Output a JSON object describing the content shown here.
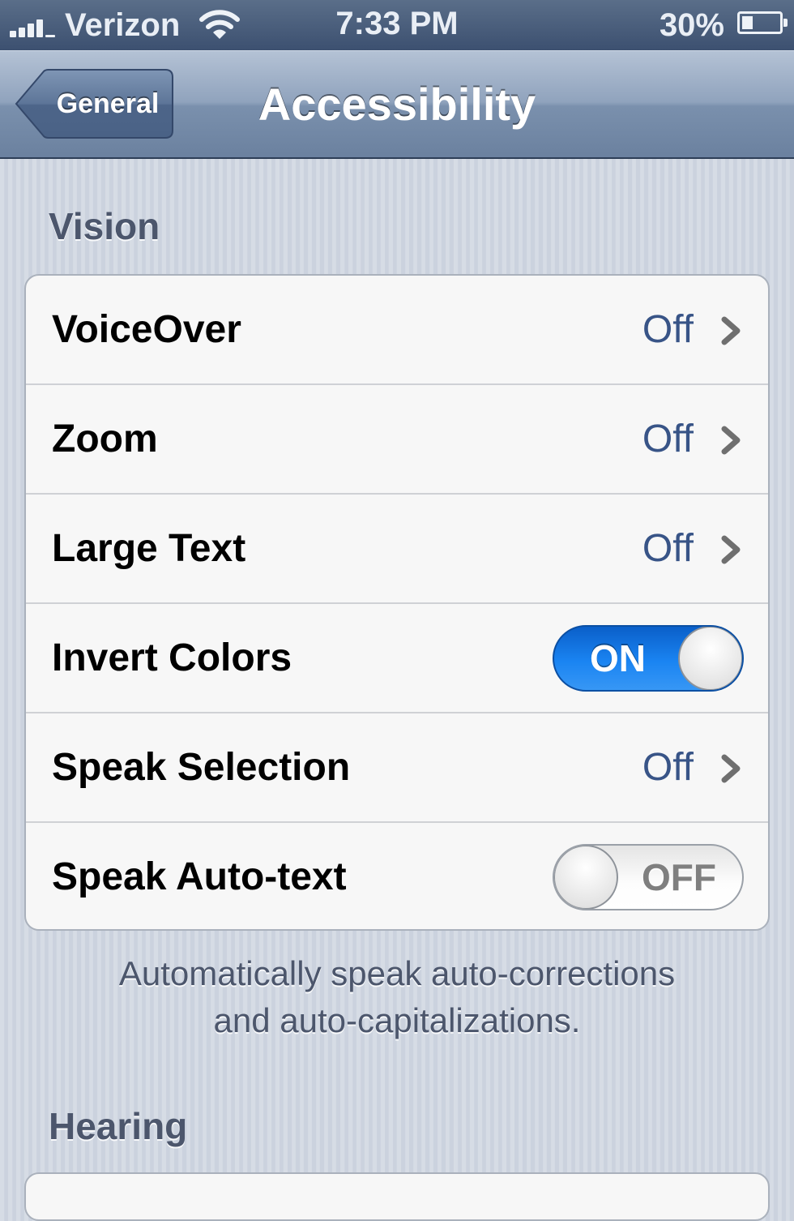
{
  "status_bar": {
    "carrier": "Verizon",
    "time": "7:33 PM",
    "battery_percent": "30%",
    "battery_level": 0.3,
    "signal_icon": "signal-bars-icon",
    "wifi_icon": "wifi-icon"
  },
  "nav_bar": {
    "back_label": "General",
    "title": "Accessibility"
  },
  "vision": {
    "header": "Vision",
    "items": [
      {
        "label": "VoiceOver",
        "value": "Off",
        "type": "disclosure"
      },
      {
        "label": "Zoom",
        "value": "Off",
        "type": "disclosure"
      },
      {
        "label": "Large Text",
        "value": "Off",
        "type": "disclosure"
      },
      {
        "label": "Invert Colors",
        "value": "ON",
        "type": "switch",
        "state": true
      },
      {
        "label": "Speak Selection",
        "value": "Off",
        "type": "disclosure"
      },
      {
        "label": "Speak Auto-text",
        "value": "OFF",
        "type": "switch",
        "state": false
      }
    ],
    "footer_line1": "Automatically speak auto-corrections",
    "footer_line2": "and auto-capitalizations."
  },
  "hearing": {
    "header": "Hearing"
  },
  "colors": {
    "switch_on": "#1a84f2",
    "value_text": "#385487",
    "nav_bar": "#7a90ad"
  }
}
